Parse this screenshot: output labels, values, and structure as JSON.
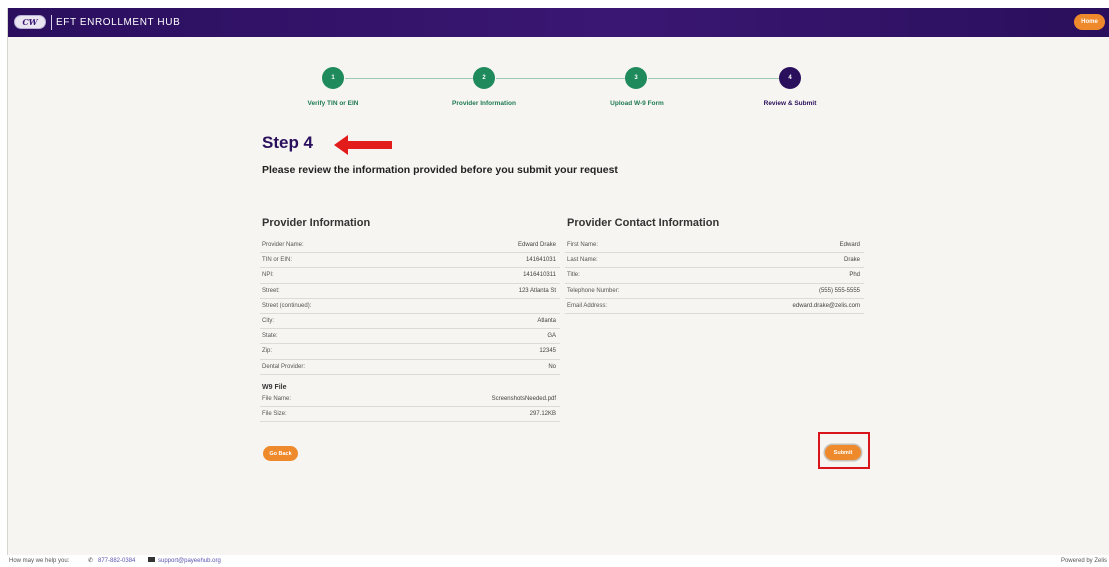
{
  "header": {
    "logo_text": "CW",
    "app_title": "EFT ENROLLMENT HUB",
    "home_label": "Home"
  },
  "stepper": {
    "steps": [
      {
        "number": "1",
        "label": "Verify TIN or EIN",
        "status": "complete"
      },
      {
        "number": "2",
        "label": "Provider Information",
        "status": "complete"
      },
      {
        "number": "3",
        "label": "Upload W-9 Form",
        "status": "complete"
      },
      {
        "number": "4",
        "label": "Review & Submit",
        "status": "current"
      }
    ]
  },
  "main": {
    "step_title": "Step 4",
    "subtitle": "Please review the information provided before you submit your request"
  },
  "provider_info": {
    "title": "Provider Information",
    "rows": [
      {
        "label": "Provider Name:",
        "value": "Edward Drake"
      },
      {
        "label": "TIN or EIN:",
        "value": "141641031"
      },
      {
        "label": "NPI:",
        "value": "1416410311"
      },
      {
        "label": "Street:",
        "value": "123 Atlanta St"
      },
      {
        "label": "Street (continued):",
        "value": ""
      },
      {
        "label": "City:",
        "value": "Atlanta"
      },
      {
        "label": "State:",
        "value": "GA"
      },
      {
        "label": "Zip:",
        "value": "12345"
      },
      {
        "label": "Dental Provider:",
        "value": "No"
      }
    ]
  },
  "w9_file": {
    "title": "W9 File",
    "rows": [
      {
        "label": "File Name:",
        "value": "ScreenshotsNeeded.pdf"
      },
      {
        "label": "File Size:",
        "value": "297.12KB"
      }
    ]
  },
  "contact_info": {
    "title": "Provider Contact Information",
    "rows": [
      {
        "label": "First Name:",
        "value": "Edward"
      },
      {
        "label": "Last Name:",
        "value": "Drake"
      },
      {
        "label": "Title:",
        "value": "Phd"
      },
      {
        "label": "Telephone Number:",
        "value": "(555) 555-5555"
      },
      {
        "label": "Email Address:",
        "value": "edward.drake@zelis.com"
      }
    ]
  },
  "actions": {
    "go_back_label": "Go Back",
    "submit_label": "Submit"
  },
  "footer": {
    "help_text": "How may we help you:",
    "phone": "877-882-0384",
    "email": "support@payeehub.org",
    "powered_by": "Powered by Zelis"
  },
  "colors": {
    "header_purple": "#2a0f5c",
    "step_complete_green": "#1f8a5b",
    "button_orange": "#ef8a2c",
    "highlight_red": "#d9141a"
  }
}
